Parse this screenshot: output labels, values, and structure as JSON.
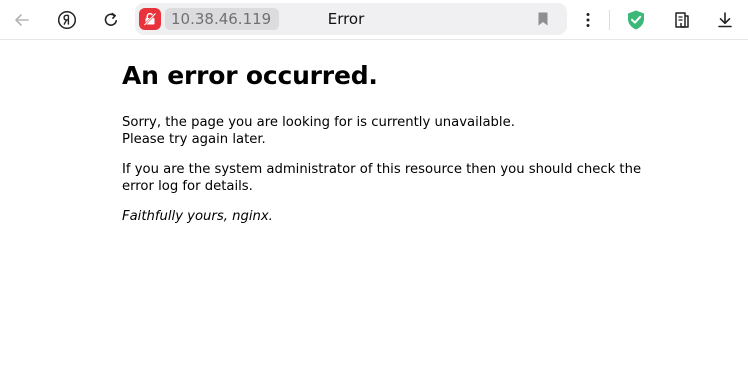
{
  "browser": {
    "address": "10.38.46.119",
    "tab_title": "Error",
    "icons": {
      "back": "back-arrow-icon",
      "yandex": "yandex-logo-icon",
      "reload": "reload-icon",
      "security": "lock-warning-icon",
      "bookmark": "bookmark-icon",
      "menu": "more-vertical-icon",
      "protect": "shield-check-icon",
      "reader": "reader-mode-icon",
      "download": "download-icon"
    },
    "colors": {
      "security_badge": "#e8323c",
      "shield": "#3cb878",
      "omnibox_bg": "#f0f0f2"
    }
  },
  "page": {
    "heading": "An error occurred.",
    "line1": "Sorry, the page you are looking for is currently unavailable.",
    "line2": "Please try again later.",
    "para2_line1": "If you are the system administrator of this resource then you should check the",
    "para2_line2": "error log for details.",
    "signature": "Faithfully yours, nginx."
  }
}
